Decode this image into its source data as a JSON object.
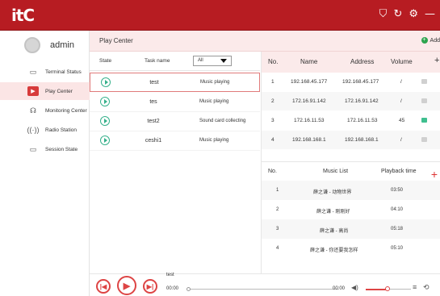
{
  "app": {
    "logo": "itC"
  },
  "user": {
    "name": "admin"
  },
  "sidebar": {
    "items": [
      {
        "label": "Terminal Status",
        "icon": "terminal-icon"
      },
      {
        "label": "Play Center",
        "icon": "play-center-icon",
        "active": true
      },
      {
        "label": "Monitoring Center",
        "icon": "headphones-icon"
      },
      {
        "label": "Radio Station",
        "icon": "radio-icon"
      },
      {
        "label": "Session State",
        "icon": "chat-icon"
      }
    ]
  },
  "breadcrumb": {
    "title": "Play Center",
    "add_label": "Add"
  },
  "task_table": {
    "headers": {
      "state": "State",
      "task_name": "Task name"
    },
    "filter": {
      "selected": "All"
    },
    "rows": [
      {
        "name": "test",
        "status": "Music playing"
      },
      {
        "name": "tes",
        "status": "Music playing"
      },
      {
        "name": "test2",
        "status": "Sound card collecting"
      },
      {
        "name": "ceshi1",
        "status": "Music playing"
      }
    ]
  },
  "terminal_table": {
    "headers": {
      "no": "No.",
      "name": "Name",
      "address": "Address",
      "volume": "Volume"
    },
    "rows": [
      {
        "no": "1",
        "name": "192.168.45.177",
        "address": "192.168.45.177",
        "volume": "/"
      },
      {
        "no": "2",
        "name": "172.16.91.142",
        "address": "172.16.91.142",
        "volume": "/"
      },
      {
        "no": "3",
        "name": "172.16.11.53",
        "address": "172.16.11.53",
        "volume": "45"
      },
      {
        "no": "4",
        "name": "192.168.168.1",
        "address": "192.168.168.1",
        "volume": "/"
      }
    ]
  },
  "music_list": {
    "headers": {
      "no": "No.",
      "music_list": "Music List",
      "playback_time": "Playback time"
    },
    "rows": [
      {
        "no": "1",
        "title": "薛之谦 - 动物世界",
        "time": "03:50"
      },
      {
        "no": "2",
        "title": "薛之谦 - 刚刚好",
        "time": "04:10"
      },
      {
        "no": "3",
        "title": "薛之谦 - 高尚",
        "time": "05:18"
      },
      {
        "no": "4",
        "title": "薛之谦 - 你还要我怎样",
        "time": "05:10"
      }
    ]
  },
  "player": {
    "track": "test",
    "elapsed": "00:00",
    "total": "00:00"
  },
  "colors": {
    "brand": "#b71c22",
    "accent": "#d44444",
    "online": "#3fbf8f"
  }
}
